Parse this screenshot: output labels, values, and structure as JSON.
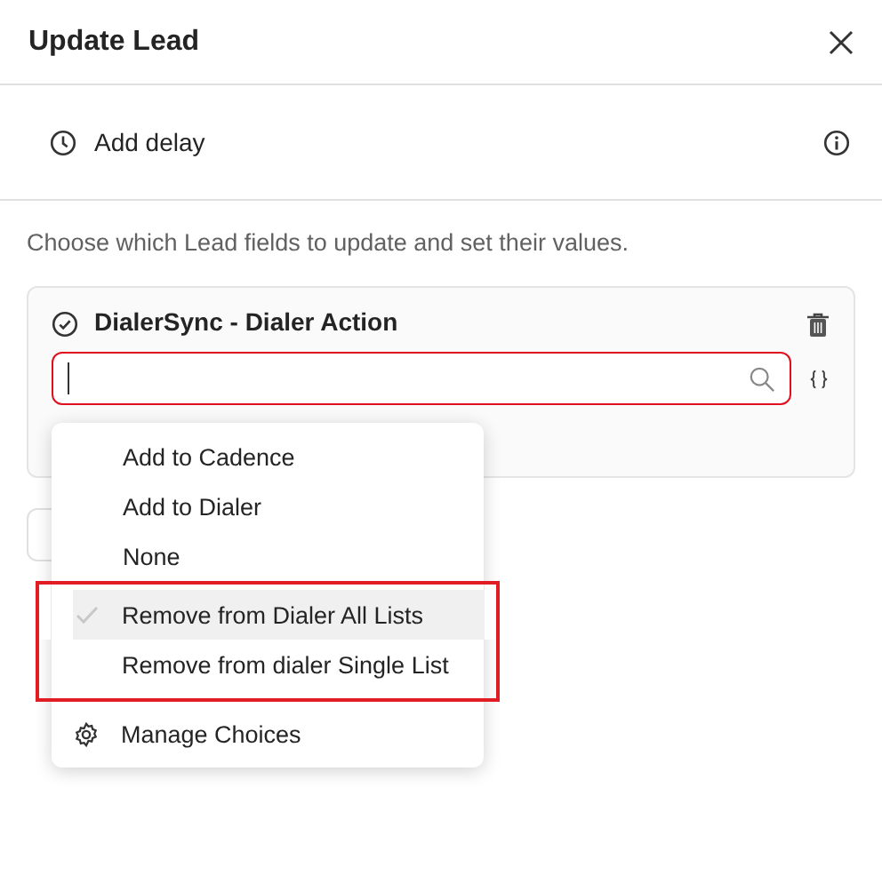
{
  "dialog": {
    "title": "Update Lead"
  },
  "delay": {
    "label": "Add delay"
  },
  "description": "Choose which Lead fields to update and set their values.",
  "field_card": {
    "title": "DialerSync - Dialer Action",
    "search": {
      "focused": true
    }
  },
  "dropdown": {
    "options": [
      {
        "label": "Add to Cadence",
        "selected": false,
        "annotated": false
      },
      {
        "label": "Add to Dialer",
        "selected": false,
        "annotated": false
      },
      {
        "label": "None",
        "selected": false,
        "annotated": false
      },
      {
        "label": "Remove from Dialer All Lists",
        "selected": true,
        "annotated": true
      },
      {
        "label": "Remove from dialer Single List",
        "selected": false,
        "annotated": true
      }
    ],
    "footer": {
      "label": "Manage Choices"
    }
  }
}
